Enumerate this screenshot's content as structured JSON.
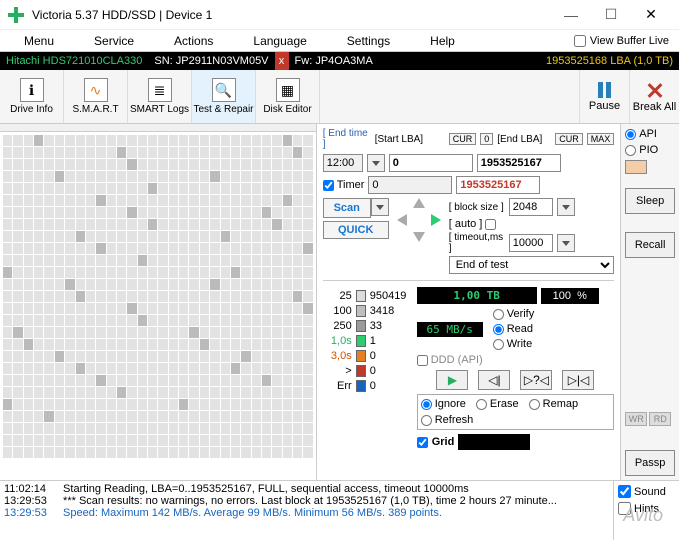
{
  "window": {
    "title": "Victoria 5.37 HDD/SSD | Device 1"
  },
  "menu": {
    "items": [
      "Menu",
      "Service",
      "Actions",
      "Language",
      "Settings",
      "Help"
    ],
    "buffer_opt": "View Buffer Live"
  },
  "device": {
    "model": "Hitachi HDS721010CLA330",
    "sn_label": "SN:",
    "sn": "JP2911N03VM05V",
    "fw_label": "Fw:",
    "fw": "JP4OA3MA",
    "lba": "1953525168 LBA (1,0 TB)"
  },
  "toolbar": {
    "drive_info": "Drive Info",
    "smart": "S.M.A.R.T",
    "smart_logs": "SMART Logs",
    "test_repair": "Test & Repair",
    "disk_editor": "Disk Editor",
    "pause": "Pause",
    "break": "Break All"
  },
  "controls": {
    "end_time_hdr": "[ End time ]",
    "start_lba_hdr": "[Start LBA]",
    "cur": "CUR",
    "zero": "0",
    "end_lba_hdr": "[End LBA]",
    "max": "MAX",
    "end_time": "12:00",
    "start_lba": "0",
    "end_lba": "1953525167",
    "timer_lbl": "Timer",
    "pos": "0",
    "pos_end": "1953525167",
    "scan_btn": "Scan",
    "quick_btn": "QUICK",
    "block_size_hdr": "[ block size ]",
    "auto_lbl": "[ auto ]",
    "block_size": "2048",
    "timeout_hdr": "[ timeout,ms ]",
    "timeout": "10000",
    "end_of_test": "End of test",
    "size_display": "1,00 TB",
    "pct_display": "100",
    "pct_sym": "%",
    "speed_display": "65 MB/s",
    "ddd_api": "DDD (API)",
    "verify": "Verify",
    "read": "Read",
    "write": "Write",
    "ignore": "Ignore",
    "erase": "Erase",
    "remap": "Remap",
    "refresh": "Refresh",
    "grid": "Grid"
  },
  "legend": {
    "rows": [
      {
        "label": "25",
        "sw": "#dcdcdc",
        "count": "950419"
      },
      {
        "label": "100",
        "sw": "#bfbfbf",
        "count": "3418"
      },
      {
        "label": "250",
        "sw": "#9a9a9a",
        "count": "33"
      },
      {
        "label": "1,0s",
        "sw": "#2ecc71",
        "count": "1",
        "lc": "#27ae60"
      },
      {
        "label": "3,0s",
        "sw": "#e67e22",
        "count": "0",
        "lc": "#d35400"
      },
      {
        "label": ">",
        "sw": "#c0392b",
        "count": "0"
      },
      {
        "label": "Err",
        "sw": "#1565c0",
        "count": "0"
      }
    ]
  },
  "right": {
    "api": "API",
    "pio": "PIO",
    "sleep": "Sleep",
    "recall": "Recall",
    "wr": "WR",
    "rd": "RD",
    "passp": "Passp"
  },
  "log": {
    "lines": [
      {
        "ts": "11:02:14",
        "txt": "Starting Reading, LBA=0..1953525167, FULL, sequential access, timeout 10000ms"
      },
      {
        "ts": "13:29:53",
        "txt": "*** Scan results: no warnings, no errors. Last block at 1953525167 (1,0 TB), time 2 hours 27 minute..."
      },
      {
        "ts": "13:29:53",
        "txt": "Speed: Maximum 142 MB/s. Average 99 MB/s. Minimum 56 MB/s. 389 points.",
        "cls": "blue"
      }
    ],
    "sound": "Sound",
    "hints": "Hints"
  },
  "map": {
    "dark": [
      3,
      27,
      41,
      58,
      72,
      95,
      110,
      134,
      159,
      177,
      192,
      205,
      224,
      236,
      247,
      261,
      279,
      299,
      313,
      330,
      352,
      366,
      380,
      397,
      418,
      432,
      449,
      463,
      481,
      498,
      512,
      529,
      545,
      563,
      577,
      592,
      609,
      625,
      641,
      660,
      677,
      694
    ]
  },
  "watermark": "Avito"
}
